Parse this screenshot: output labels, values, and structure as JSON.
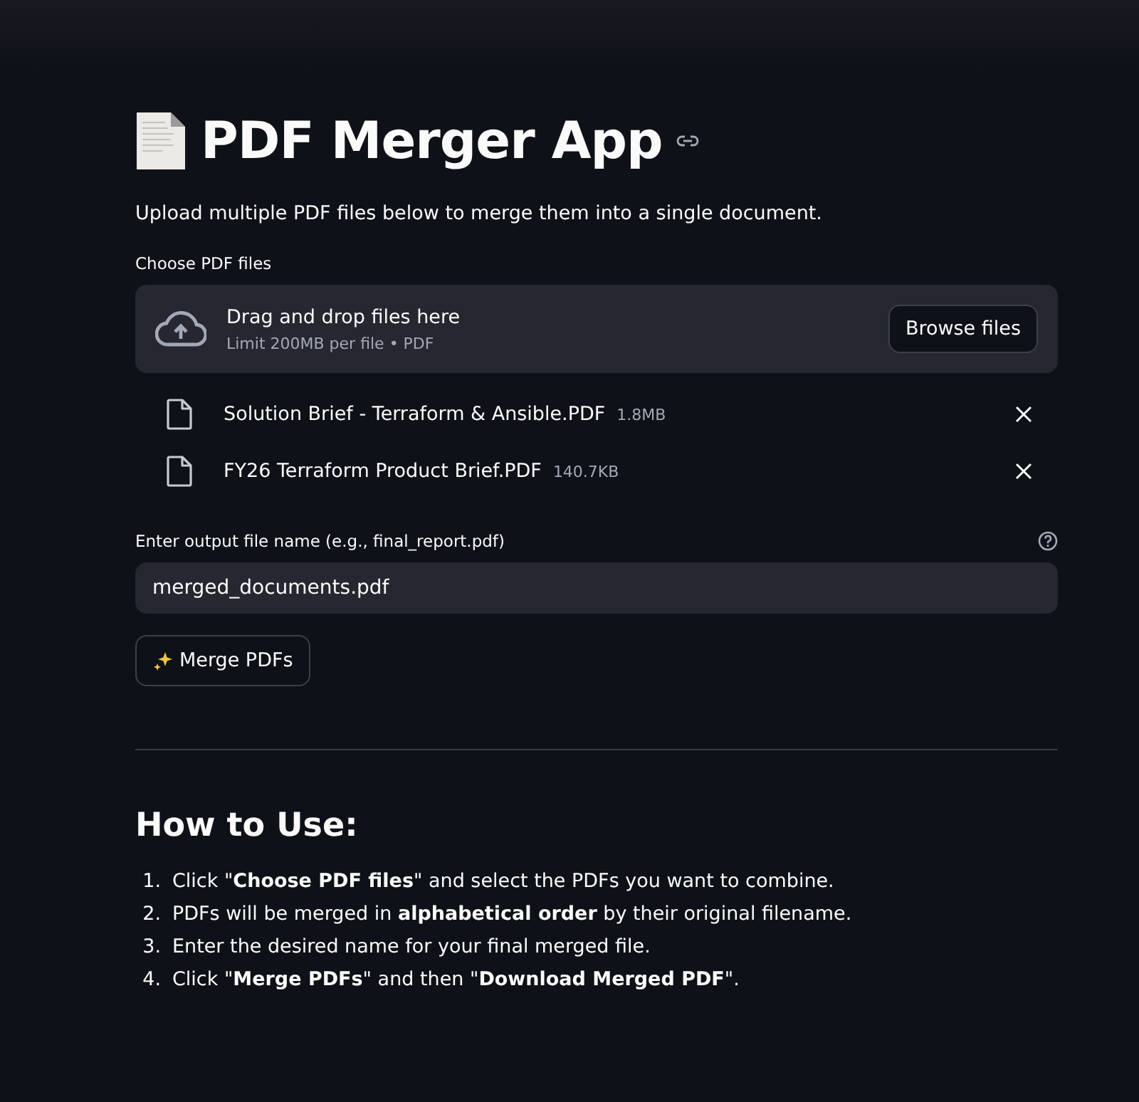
{
  "title": "PDF Merger App",
  "intro": "Upload multiple PDF files below to merge them into a single document.",
  "uploader": {
    "label": "Choose PDF files",
    "drop_text": "Drag and drop files here",
    "limit_text": "Limit 200MB per file • PDF",
    "button": "Browse files",
    "files": [
      {
        "name": "Solution Brief - Terraform & Ansible.PDF",
        "size": "1.8MB"
      },
      {
        "name": "FY26 Terraform Product Brief.PDF",
        "size": "140.7KB"
      }
    ]
  },
  "output_name": {
    "label": "Enter output file name (e.g., final_report.pdf)",
    "value": "merged_documents.pdf"
  },
  "merge_button": "Merge PDFs",
  "how_to": {
    "heading": "How to Use:",
    "steps": [
      {
        "number": "1.",
        "text": "Click \"**Choose PDF files**\" and select the PDFs you want to combine."
      },
      {
        "number": "2.",
        "text": "PDFs will be merged in **alphabetical order** by their original filename."
      },
      {
        "number": "3.",
        "text": "Enter the desired name for your final merged file."
      },
      {
        "number": "4.",
        "text": "Click \"**Merge PDFs**\" and then \"**Download Merged PDF**\"."
      }
    ]
  }
}
